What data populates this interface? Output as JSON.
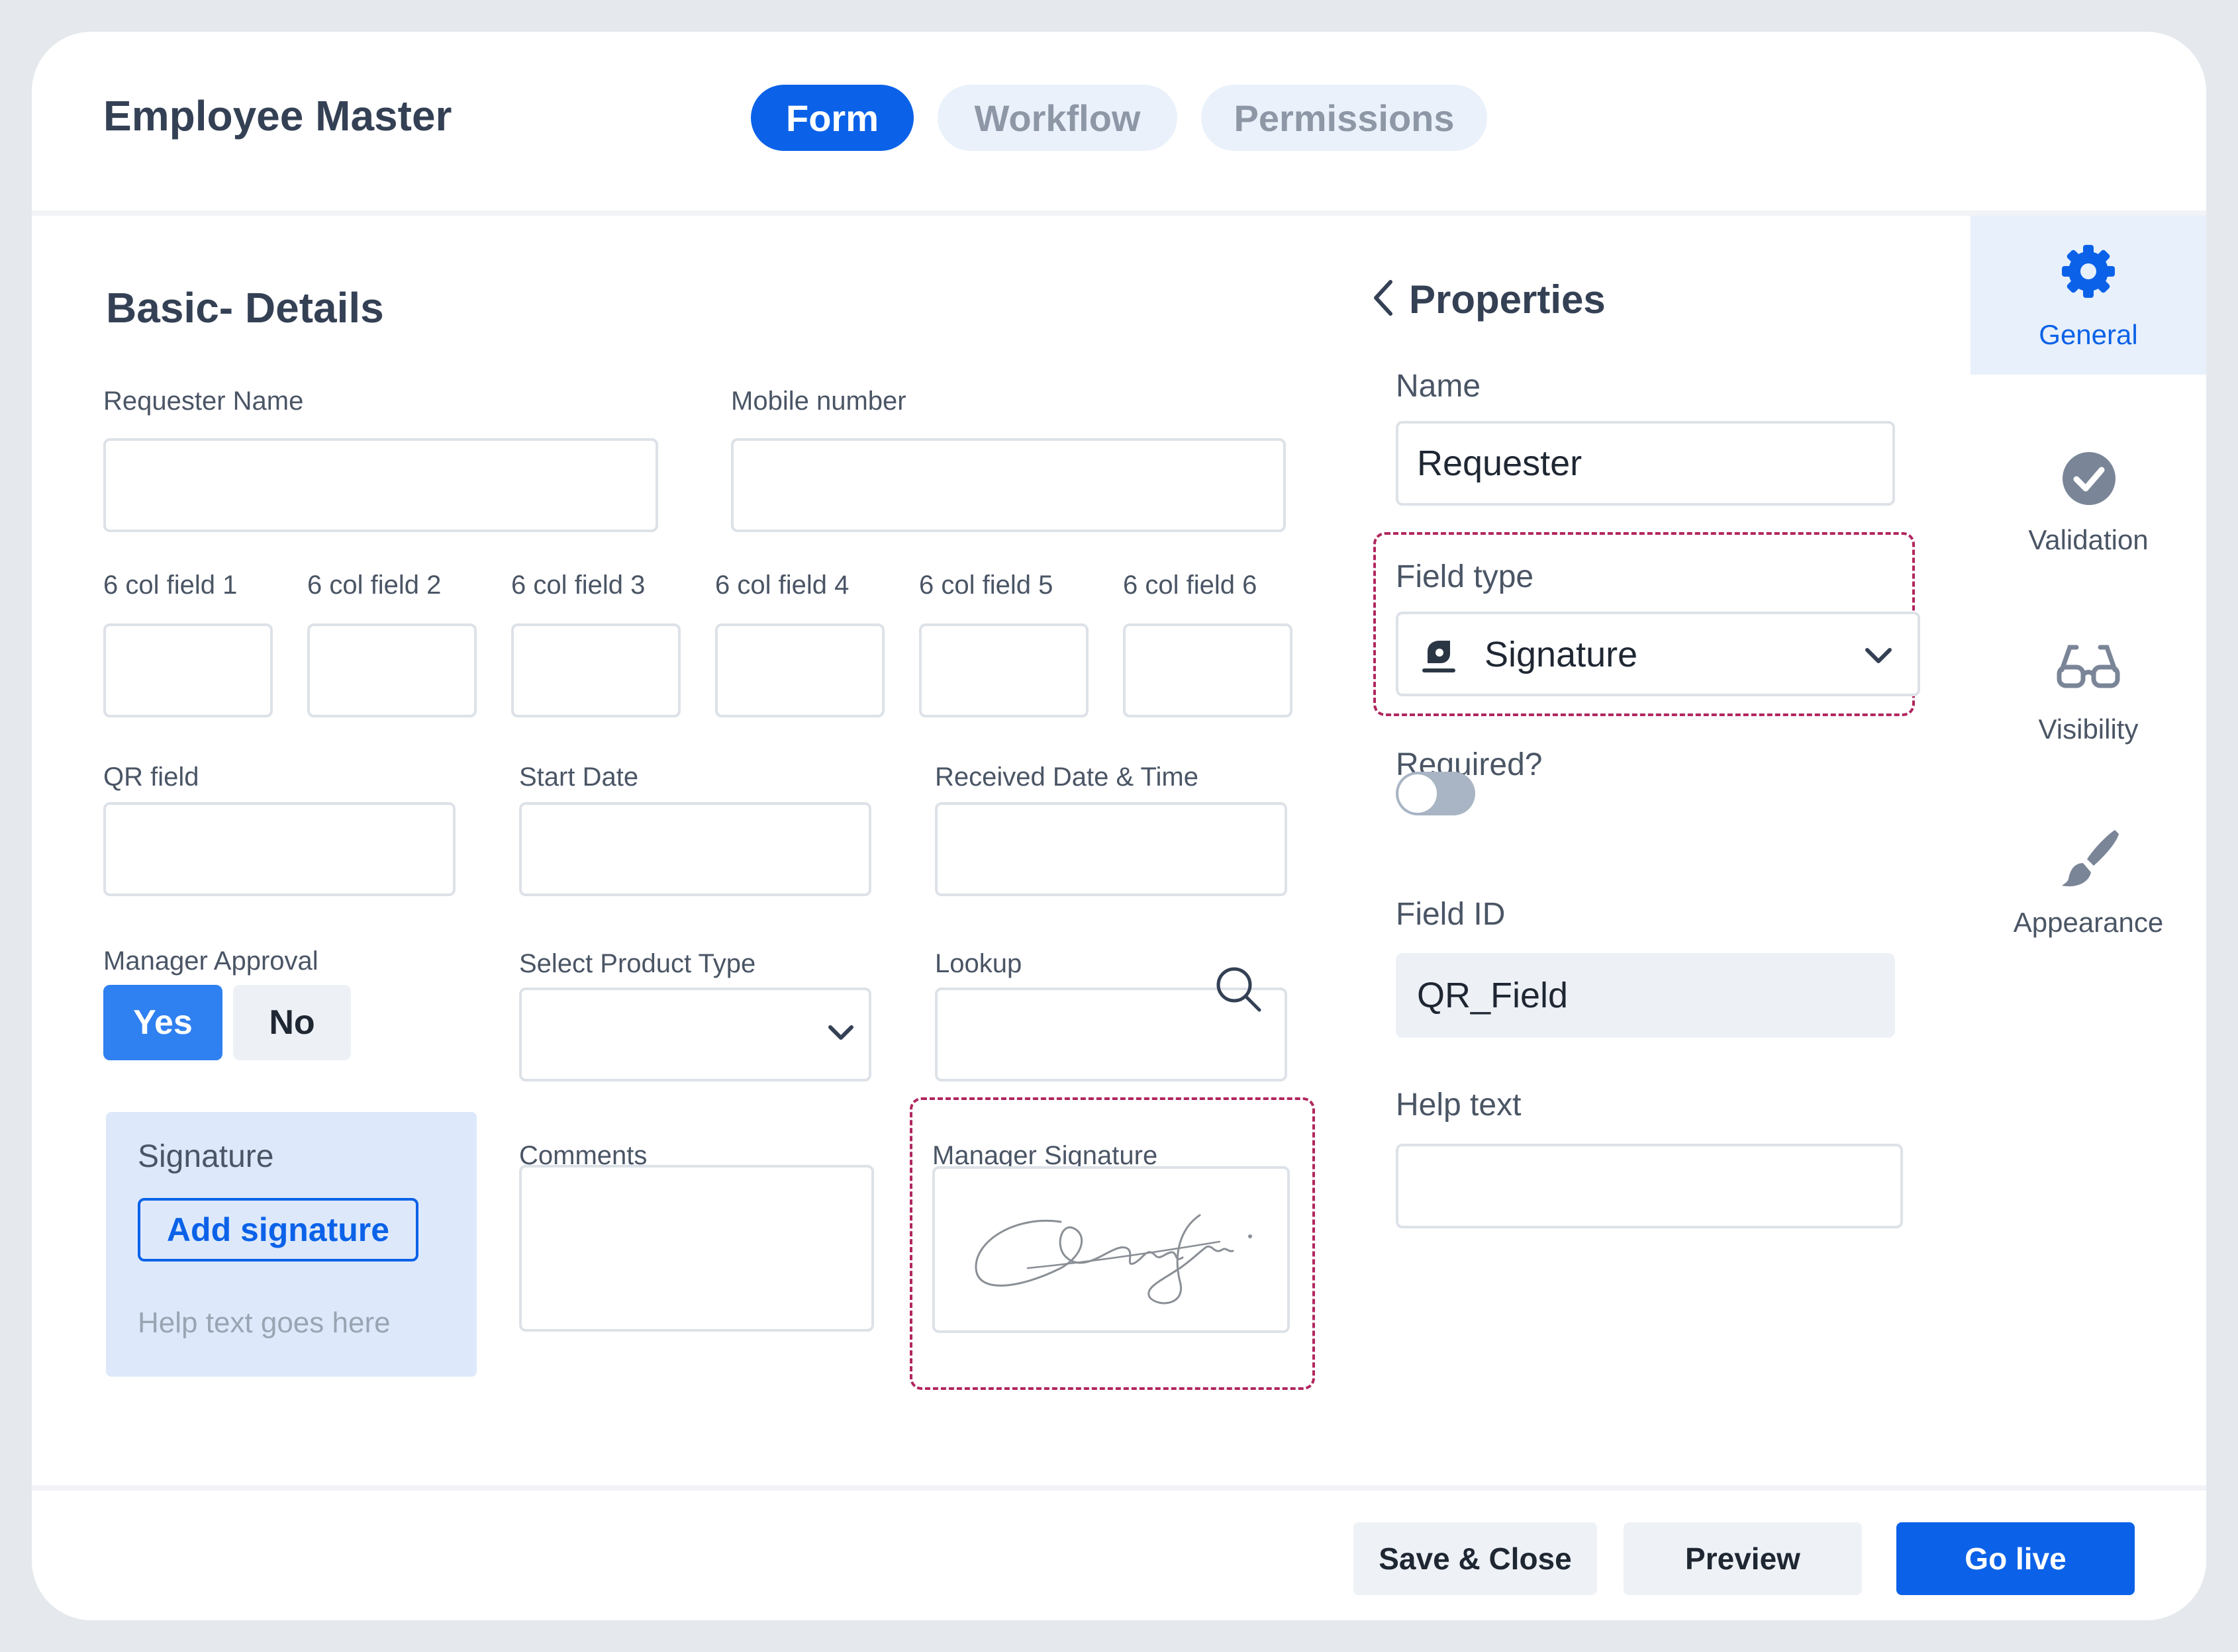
{
  "app": {
    "title": "Employee Master",
    "tabs": [
      {
        "label": "Form",
        "active": true
      },
      {
        "label": "Workflow",
        "active": false
      },
      {
        "label": "Permissions",
        "active": false
      }
    ]
  },
  "form": {
    "section_title": "Basic- Details",
    "requester_name_label": "Requester Name",
    "mobile_number_label": "Mobile number",
    "six_col_labels": [
      "6 col field 1",
      "6 col field 2",
      "6 col field 3",
      "6 col field 4",
      "6 col field 5",
      "6 col field 6"
    ],
    "qr_field_label": "QR field",
    "start_date_label": "Start Date",
    "received_label": "Received Date & Time",
    "manager_approval_label": "Manager Approval",
    "yes_label": "Yes",
    "no_label": "No",
    "selected_approval": "Yes",
    "product_type_label": "Select Product Type",
    "lookup_label": "Lookup",
    "signature_card": {
      "title": "Signature",
      "button": "Add signature",
      "help": "Help text goes here"
    },
    "comments_label": "Comments",
    "manager_signature_label": "Manager Signature"
  },
  "properties": {
    "title": "Properties",
    "name_label": "Name",
    "name_value": "Requester",
    "field_type_label": "Field type",
    "field_type_value": "Signature",
    "required_label": "Required?",
    "required": false,
    "field_id_label": "Field ID",
    "field_id_value": "QR_Field",
    "help_text_label": "Help text",
    "help_text_value": ""
  },
  "rail": [
    {
      "label": "General",
      "icon": "gear-icon",
      "active": true
    },
    {
      "label": "Validation",
      "icon": "check-circle-icon",
      "active": false
    },
    {
      "label": "Visibility",
      "icon": "glasses-icon",
      "active": false
    },
    {
      "label": "Appearance",
      "icon": "paintbrush-icon",
      "active": false
    }
  ],
  "footer": {
    "save_close": "Save  & Close",
    "preview": "Preview",
    "go_live": "Go live"
  },
  "colors": {
    "primary": "#0b62e8",
    "highlight_dashed": "#b0265f",
    "signature_card_bg": "#dde9fb",
    "rail_active_bg": "#e8f0fb"
  }
}
